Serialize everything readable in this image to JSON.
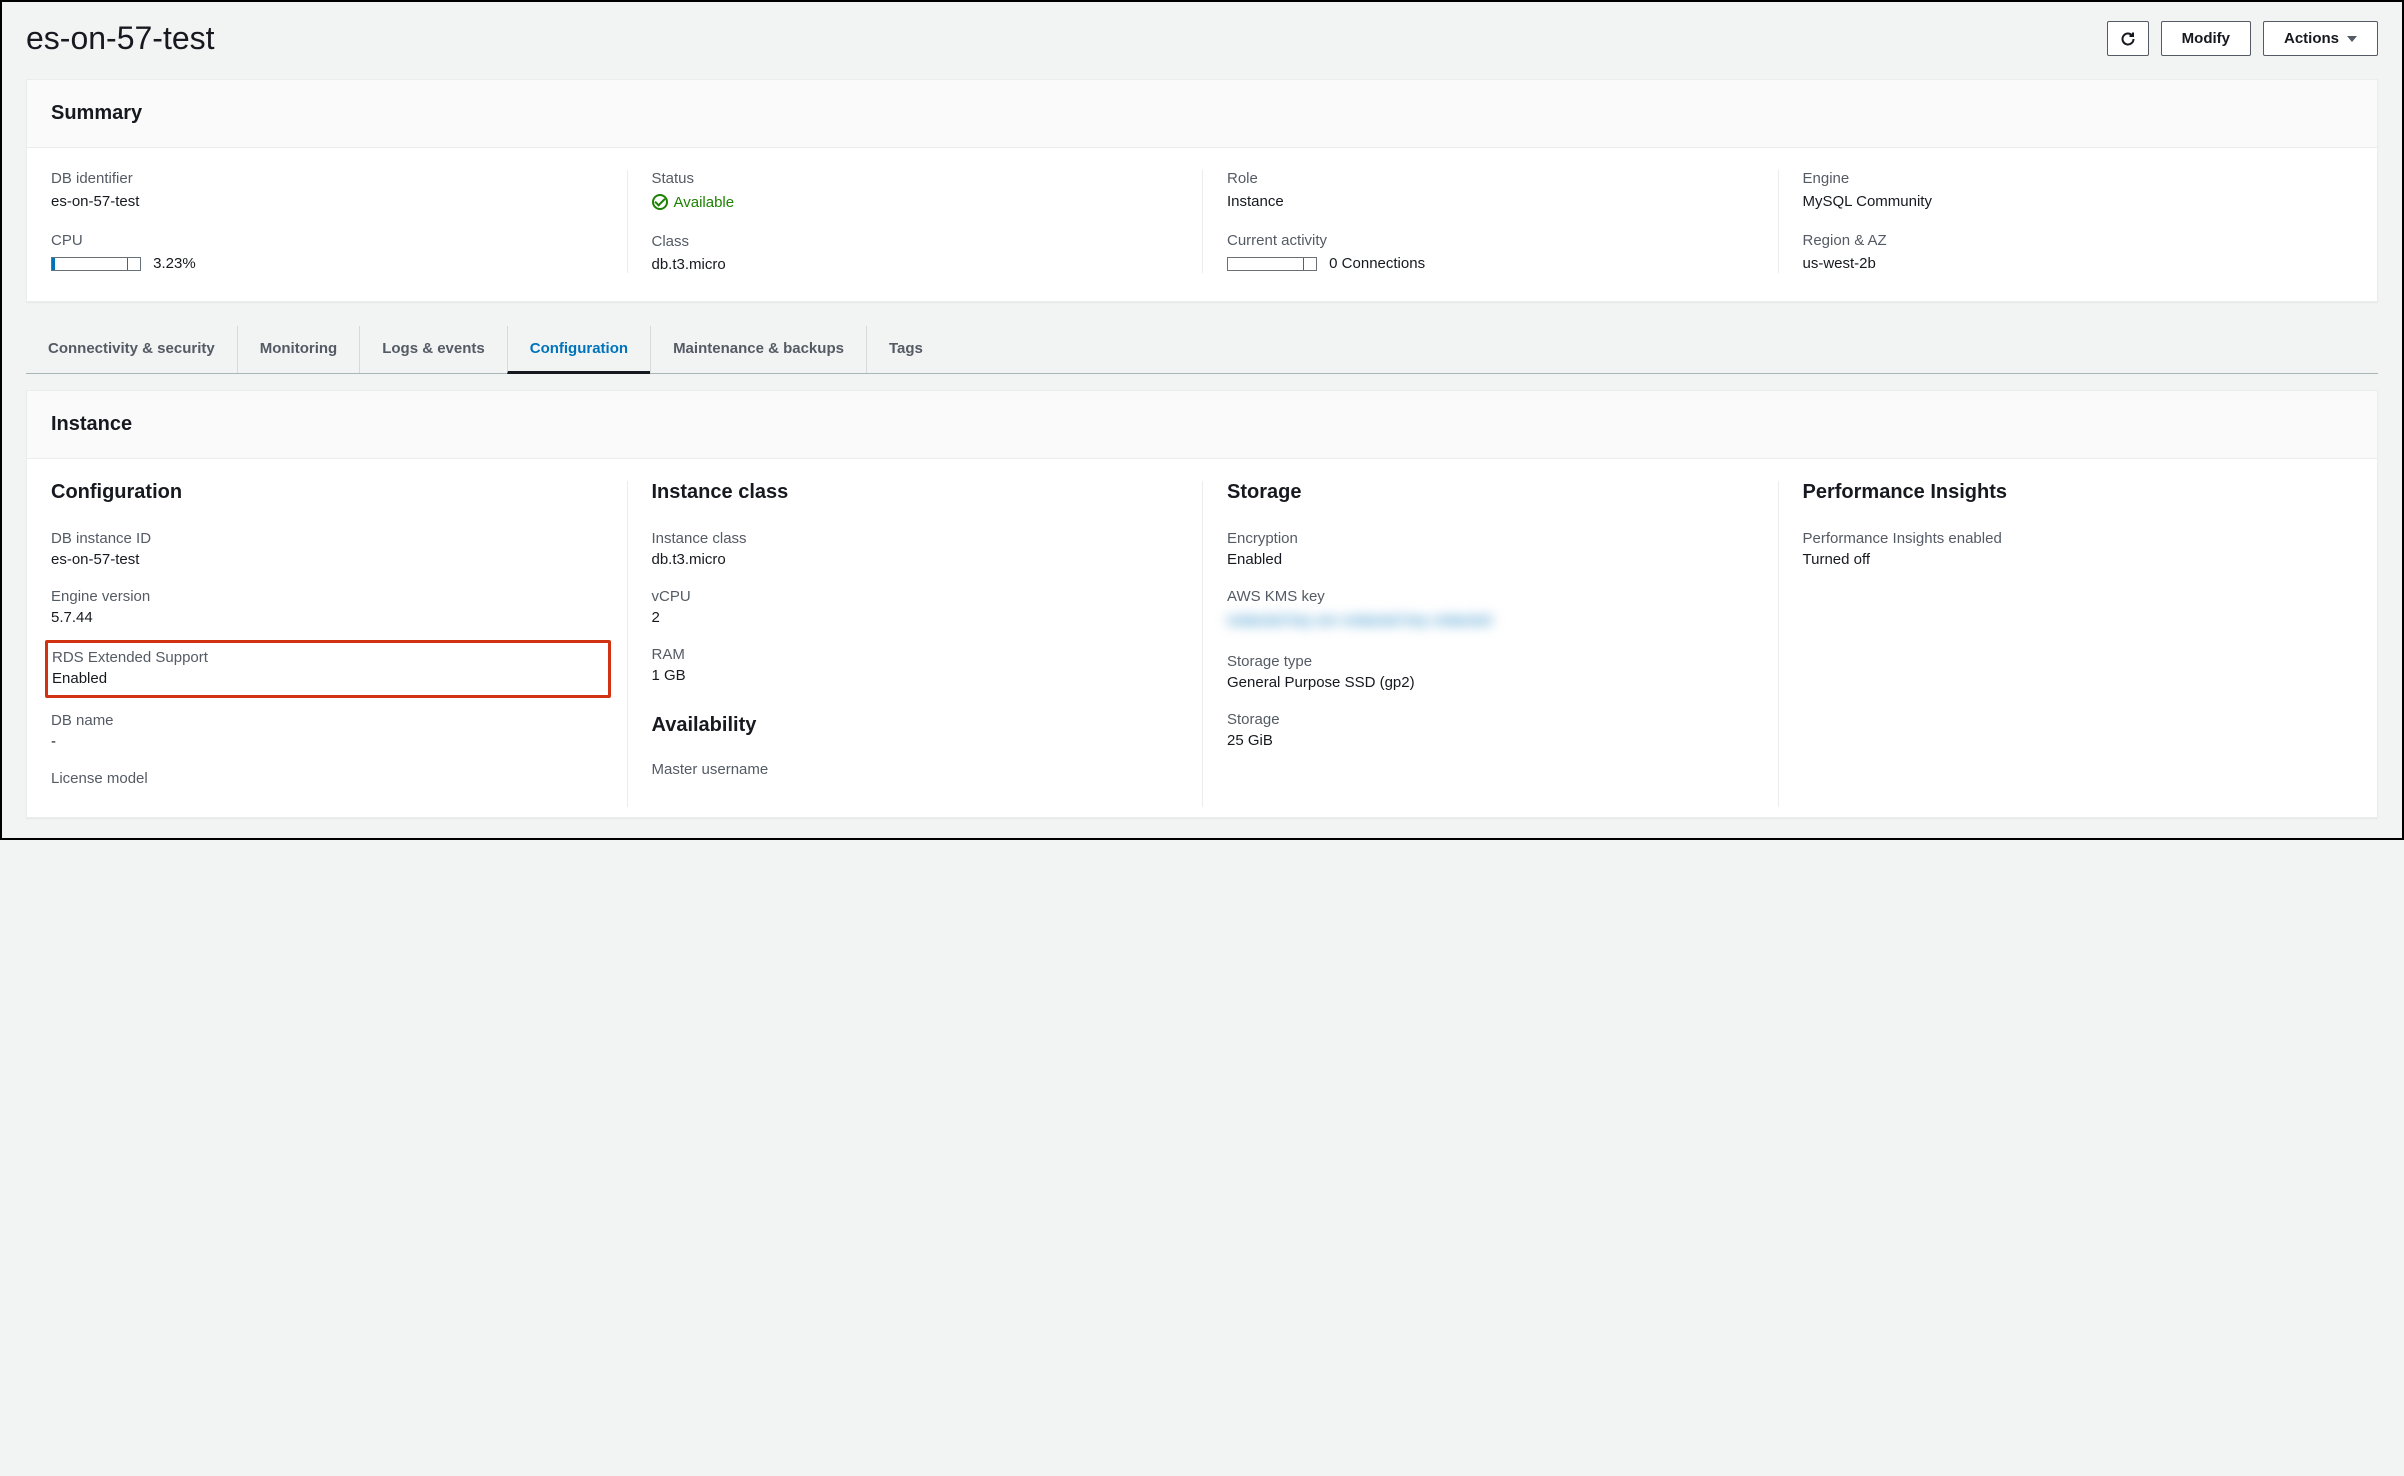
{
  "header": {
    "title": "es-on-57-test",
    "modify_label": "Modify",
    "actions_label": "Actions"
  },
  "summary": {
    "title": "Summary",
    "db_identifier": {
      "label": "DB identifier",
      "value": "es-on-57-test"
    },
    "cpu": {
      "label": "CPU",
      "value": "3.23%",
      "percent": 3.23
    },
    "status": {
      "label": "Status",
      "value": "Available"
    },
    "class": {
      "label": "Class",
      "value": "db.t3.micro"
    },
    "role": {
      "label": "Role",
      "value": "Instance"
    },
    "current_activity": {
      "label": "Current activity",
      "value": "0 Connections"
    },
    "engine": {
      "label": "Engine",
      "value": "MySQL Community"
    },
    "region_az": {
      "label": "Region & AZ",
      "value": "us-west-2b"
    }
  },
  "tabs": [
    {
      "label": "Connectivity & security",
      "active": false
    },
    {
      "label": "Monitoring",
      "active": false
    },
    {
      "label": "Logs & events",
      "active": false
    },
    {
      "label": "Configuration",
      "active": true
    },
    {
      "label": "Maintenance & backups",
      "active": false
    },
    {
      "label": "Tags",
      "active": false
    }
  ],
  "instance": {
    "title": "Instance",
    "configuration": {
      "heading": "Configuration",
      "db_instance_id": {
        "label": "DB instance ID",
        "value": "es-on-57-test"
      },
      "engine_version": {
        "label": "Engine version",
        "value": "5.7.44"
      },
      "rds_extended_support": {
        "label": "RDS Extended Support",
        "value": "Enabled"
      },
      "db_name": {
        "label": "DB name",
        "value": "-"
      },
      "license_model": {
        "label": "License model"
      }
    },
    "instance_class": {
      "heading": "Instance class",
      "instance_class": {
        "label": "Instance class",
        "value": "db.t3.micro"
      },
      "vcpu": {
        "label": "vCPU",
        "value": "2"
      },
      "ram": {
        "label": "RAM",
        "value": "1 GB"
      },
      "availability_heading": "Availability",
      "master_username": {
        "label": "Master username"
      }
    },
    "storage": {
      "heading": "Storage",
      "encryption": {
        "label": "Encryption",
        "value": "Enabled"
      },
      "kms_key": {
        "label": "AWS KMS key",
        "value_redacted": "redacted key arn redacted key redacted"
      },
      "storage_type": {
        "label": "Storage type",
        "value": "General Purpose SSD (gp2)"
      },
      "storage": {
        "label": "Storage",
        "value": "25 GiB"
      }
    },
    "performance_insights": {
      "heading": "Performance Insights",
      "enabled": {
        "label": "Performance Insights enabled",
        "value": "Turned off"
      }
    }
  }
}
